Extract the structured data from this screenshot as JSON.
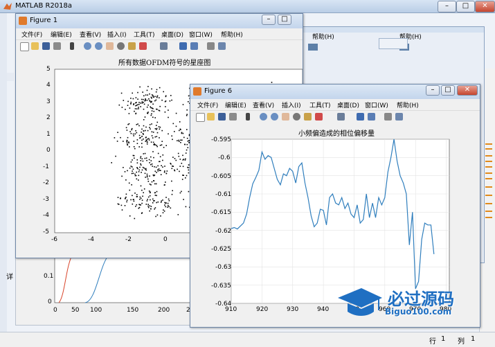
{
  "app": {
    "title": "MATLAB R2018a"
  },
  "status": {
    "row_label": "行",
    "row_value": "1",
    "col_label": "列",
    "col_value": "1"
  },
  "menu": [
    "文件(F)",
    "编辑(E)",
    "查看(V)",
    "插入(I)",
    "工具(T)",
    "桌面(D)",
    "窗口(W)",
    "帮助(H)"
  ],
  "bg_menu_fragment": "帮助(H)",
  "fig1": {
    "title": "Figure 1",
    "plot_title": "所有数据OFDM符号的星座图",
    "xticks": [
      "-6",
      "-4",
      "-2",
      "0"
    ],
    "yticks": [
      "5",
      "4",
      "3",
      "2",
      "1",
      "0",
      "-1",
      "-2",
      "-3",
      "-4",
      "-5"
    ]
  },
  "fig6": {
    "title": "Figure 6",
    "plot_title": "小频偏造成的相位偏移量",
    "xticks": [
      "910",
      "920",
      "930",
      "940",
      "950",
      "960",
      "970",
      "980"
    ],
    "yticks": [
      "-0.595",
      "-0.6",
      "-0.605",
      "-0.61",
      "-0.615",
      "-0.62",
      "-0.625",
      "-0.63",
      "-0.635",
      "-0.64"
    ]
  },
  "bg_plot": {
    "xticks": [
      "0",
      "50",
      "100",
      "150",
      "200",
      "2"
    ],
    "yticks": [
      "0.1",
      "0"
    ],
    "side_label": "详"
  },
  "watermark": {
    "text": "必过源码",
    "url": "Biguo100.com"
  },
  "colors": {
    "line": "#2f7ebd",
    "scatter": "#000000",
    "red_curve": "#d9452b",
    "accent": "#1f6fc2"
  },
  "chart_data": [
    {
      "type": "scatter",
      "title": "所有数据OFDM符号的星座图",
      "xlim": [
        -6,
        2
      ],
      "ylim": [
        -5,
        5
      ],
      "clusters": [
        {
          "x": 0,
          "y": 0,
          "weight": "dense"
        },
        {
          "x": -1,
          "y": 1,
          "weight": "medium"
        },
        {
          "x": -1,
          "y": -1,
          "weight": "medium"
        },
        {
          "x": -3,
          "y": 3,
          "weight": "light"
        },
        {
          "x": -3,
          "y": 1,
          "weight": "light"
        },
        {
          "x": -3,
          "y": -1,
          "weight": "light"
        },
        {
          "x": -3,
          "y": -3,
          "weight": "light"
        },
        {
          "x": -1,
          "y": 3,
          "weight": "light"
        },
        {
          "x": -1,
          "y": -3,
          "weight": "light"
        },
        {
          "x": 1,
          "y": 3,
          "weight": "light"
        },
        {
          "x": 1,
          "y": 1,
          "weight": "light"
        },
        {
          "x": 1,
          "y": -1,
          "weight": "light"
        },
        {
          "x": 1,
          "y": -3,
          "weight": "light"
        }
      ]
    },
    {
      "type": "line",
      "title": "小频偏造成的相位偏移量",
      "xlim": [
        910,
        981
      ],
      "ylim": [
        -0.64,
        -0.595
      ],
      "x": [
        910,
        911,
        912,
        913,
        914,
        915,
        916,
        917,
        918,
        919,
        920,
        921,
        922,
        923,
        924,
        925,
        926,
        927,
        928,
        929,
        930,
        931,
        932,
        933,
        934,
        935,
        936,
        937,
        938,
        939,
        940,
        941,
        942,
        943,
        944,
        945,
        946,
        947,
        948,
        949,
        950,
        951,
        952,
        953,
        954,
        955,
        956,
        957,
        958,
        959,
        960,
        961,
        962,
        963,
        964,
        965,
        966,
        967,
        968,
        969,
        970,
        971,
        972,
        973,
        974,
        975,
        976
      ],
      "y": [
        -0.6195,
        -0.6192,
        -0.6196,
        -0.6188,
        -0.618,
        -0.6155,
        -0.611,
        -0.6072,
        -0.6055,
        -0.6035,
        -0.5985,
        -0.6005,
        -0.5995,
        -0.6,
        -0.603,
        -0.606,
        -0.6075,
        -0.6045,
        -0.605,
        -0.603,
        -0.6038,
        -0.607,
        -0.6025,
        -0.6015,
        -0.607,
        -0.611,
        -0.616,
        -0.619,
        -0.618,
        -0.6142,
        -0.6145,
        -0.6185,
        -0.611,
        -0.61,
        -0.6125,
        -0.613,
        -0.611,
        -0.614,
        -0.6125,
        -0.6155,
        -0.6165,
        -0.613,
        -0.618,
        -0.617,
        -0.61,
        -0.6165,
        -0.6125,
        -0.6165,
        -0.611,
        -0.613,
        -0.611,
        -0.604,
        -0.6,
        -0.595,
        -0.601,
        -0.605,
        -0.607,
        -0.61,
        -0.624,
        -0.615,
        -0.636,
        -0.634,
        -0.6225,
        -0.618,
        -0.6185,
        -0.6185,
        -0.6265
      ]
    }
  ]
}
